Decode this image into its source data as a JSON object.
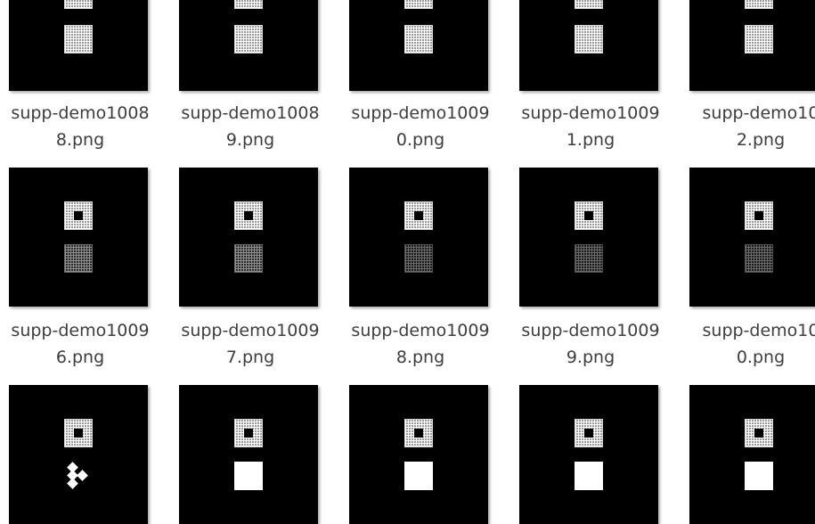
{
  "files": [
    {
      "name_line1": "supp-demo1008",
      "name_line2": "8.png"
    },
    {
      "name_line1": "supp-demo1008",
      "name_line2": "9.png"
    },
    {
      "name_line1": "supp-demo1009",
      "name_line2": "0.png"
    },
    {
      "name_line1": "supp-demo1009",
      "name_line2": "1.png"
    },
    {
      "name_line1": "supp-demo10",
      "name_line2": "2.png"
    },
    {
      "name_line1": "supp-demo1009",
      "name_line2": "6.png"
    },
    {
      "name_line1": "supp-demo1009",
      "name_line2": "7.png"
    },
    {
      "name_line1": "supp-demo1009",
      "name_line2": "8.png"
    },
    {
      "name_line1": "supp-demo1009",
      "name_line2": "9.png"
    },
    {
      "name_line1": "supp-demo10",
      "name_line2": "0.png"
    },
    {
      "name_line1": "",
      "name_line2": ""
    },
    {
      "name_line1": "",
      "name_line2": ""
    },
    {
      "name_line1": "",
      "name_line2": ""
    },
    {
      "name_line1": "",
      "name_line2": ""
    },
    {
      "name_line1": "",
      "name_line2": ""
    }
  ],
  "colors": {
    "thumbnail_background": "#000000",
    "label_text": "#3d3d3d",
    "page_background": "#ffffff"
  }
}
